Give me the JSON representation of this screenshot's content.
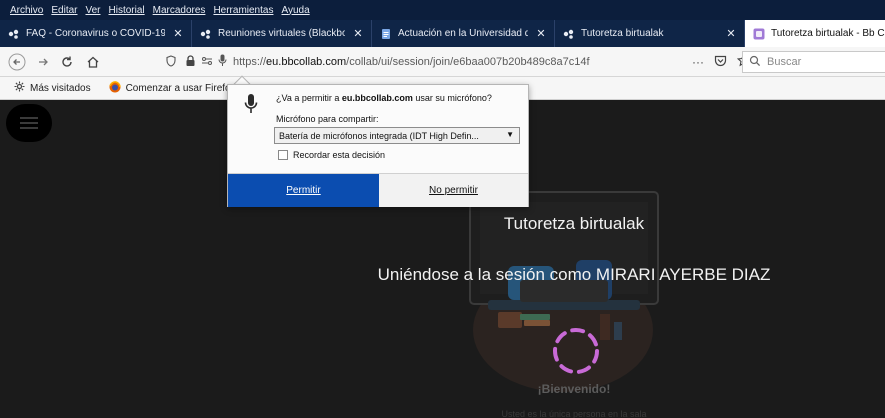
{
  "menubar": {
    "items": [
      "Archivo",
      "Editar",
      "Ver",
      "Historial",
      "Marcadores",
      "Herramientas",
      "Ayuda"
    ]
  },
  "tabs": [
    {
      "label": "FAQ - Coronavirus o COVID-19",
      "close": "✕",
      "icon": "blackboard-icon",
      "active": false
    },
    {
      "label": "Reuniones virtuales (Blackboard",
      "close": "✕",
      "icon": "blackboard-icon",
      "active": false
    },
    {
      "label": "Actuación en la Universidad de",
      "close": "✕",
      "icon": "document-icon",
      "active": false
    },
    {
      "label": "Tutoretza birtualak",
      "close": "✕",
      "icon": "blackboard-icon",
      "active": false
    },
    {
      "label": "Tutoretza birtualak - Bb C",
      "close": "",
      "icon": "collab-icon",
      "active": true
    }
  ],
  "navbar": {
    "url_prefix": "https://",
    "url_host": "eu.bbcollab.com",
    "url_path": "/collab/ui/session/join/e6baa007b20b489c8a7c14f",
    "more": "···",
    "search_placeholder": "Buscar"
  },
  "bookmarks": [
    {
      "label": "Más visitados",
      "icon": "gear-icon"
    },
    {
      "label": "Comenzar a usar Firefox",
      "icon": "firefox-icon"
    }
  ],
  "content": {
    "session_title": "Tutoretza birtualak",
    "joining_text": "Uniéndose a la sesión como MIRARI AYERBE DIAZ",
    "welcome": "¡Bienvenido!",
    "welcome_sub": "Usted es la única persona en la sala"
  },
  "permission": {
    "question_prefix": "¿Va a permitir a ",
    "question_host": "eu.bbcollab.com",
    "question_suffix": " usar su micrófono?",
    "mic_label": "Micrófono para compartir:",
    "mic_selected": "Batería de micrófonos integrada (IDT High Defin...",
    "remember_label": "Recordar esta decisión",
    "allow_label": "Permitir",
    "deny_label": "No permitir"
  },
  "colors": {
    "tabbar": "#0f2547",
    "allow_button": "#0b4db0",
    "page_bg": "#1b1b1b",
    "spinner": "#c86ad6"
  }
}
